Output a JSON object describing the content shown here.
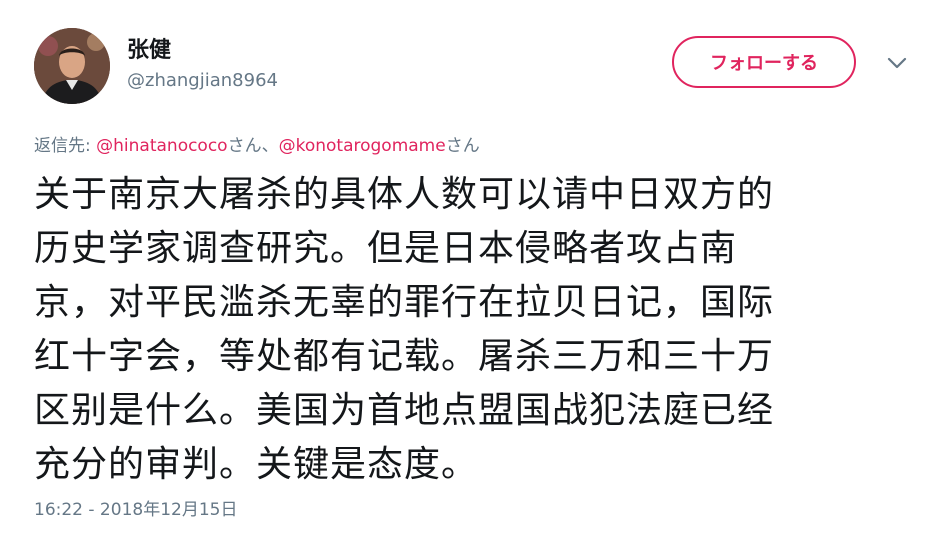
{
  "user": {
    "display_name": "张健",
    "handle": "@zhangjian8964"
  },
  "follow_button": {
    "label": "フォローする"
  },
  "reply": {
    "prefix": "返信先: ",
    "mention1": "@hinatanococo",
    "joiner1": "さん、",
    "mention2": "@konotarogomame",
    "joiner2": "さん"
  },
  "tweet": {
    "lines": [
      "关于南京大屠杀的具体人数可以请中日双方的",
      "历史学家调查研究。但是日本侵略者攻占南",
      "京，对平民滥杀无辜的罪行在拉贝日记，国际",
      "红十字会，等处都有记载。屠杀三万和三十万",
      "区别是什么。美国为首地点盟国战犯法庭已经",
      "充分的审判。关键是态度。"
    ]
  },
  "timestamp": "16:22 - 2018年12月15日",
  "icons": {
    "avatar": "profile-photo",
    "caret": "chevron-down-icon"
  },
  "colors": {
    "accent": "#e0245e",
    "secondary_text": "#657786",
    "primary_text": "#14171a"
  }
}
